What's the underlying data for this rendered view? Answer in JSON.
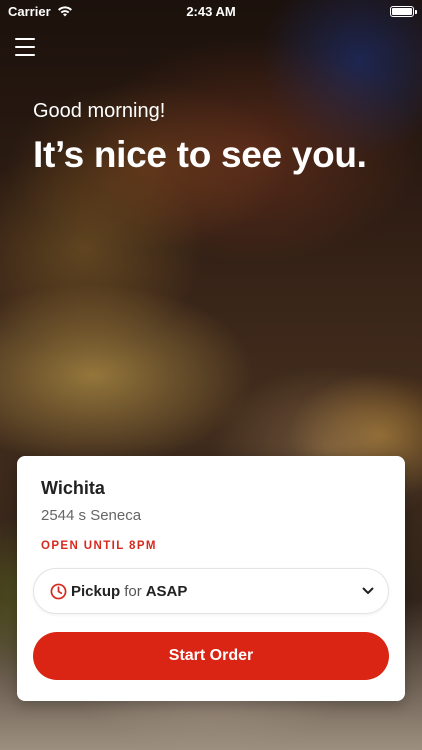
{
  "status_bar": {
    "carrier": "Carrier",
    "time": "2:43 AM",
    "battery_level": 1.0
  },
  "header": {
    "greeting": "Good morning!",
    "headline": "It’s nice to see you."
  },
  "location_card": {
    "name": "Wichita",
    "address": "2544 s Seneca",
    "open_status": "OPEN UNTIL 8PM",
    "pickup": {
      "mode": "Pickup",
      "for_label": "for",
      "time": "ASAP"
    },
    "start_button_label": "Start Order"
  },
  "colors": {
    "accent": "#da2414",
    "status_text": "#d62a1e"
  },
  "icons": {
    "menu": "hamburger-icon",
    "clock": "clock-icon",
    "dropdown": "chevron-down-icon",
    "wifi": "wifi-icon",
    "battery": "battery-icon"
  }
}
